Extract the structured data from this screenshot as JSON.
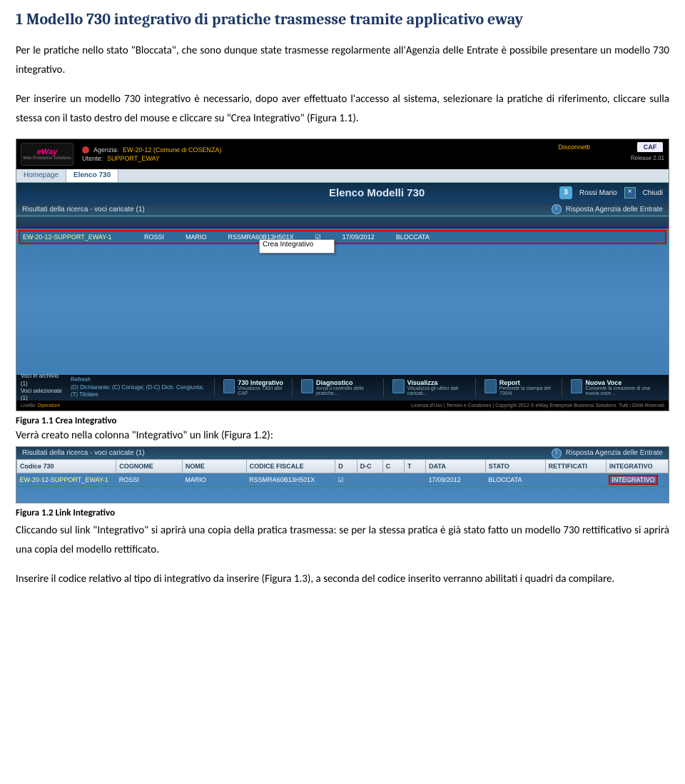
{
  "doc": {
    "heading": "1  Modello 730 integrativo di pratiche trasmesse tramite applicativo eway",
    "para1": "Per le pratiche nello stato \"Bloccata\", che sono dunque state trasmesse regolarmente all'Agenzia delle Entrate è possibile presentare un modello 730 integrativo.",
    "para2": "Per inserire un modello 730 integrativo è necessario, dopo aver effettuato l'accesso al sistema, selezionare la pratiche di riferimento, cliccare sulla stessa con il tasto destro del mouse e cliccare su \"Crea Integrativo\" (Figura 1.1).",
    "caption1": "Figura 1.1 Crea Integrativo",
    "after1": "Verrà creato nella colonna \"Integrativo\" un link (Figura 1.2):",
    "caption2": "Figura 1.2 Link Integrativo",
    "para3": "Cliccando sul link \"Integrativo\" si aprirà una copia della pratica trasmessa: se per la stessa pratica è già stato fatto un modello 730 rettificativo si aprirà una copia del modello rettificato.",
    "para4": "Inserire il codice relativo al tipo di integrativo da inserire (Figura 1.3), a seconda del codice inserito verranno abilitati i quadri da compilare."
  },
  "ss1": {
    "brand": "eWay",
    "brandSub": "Web Enterprise Solutions",
    "agenziaLabel": "Agenzia:",
    "agenziaVal": "EW-20-12 (Comune di COSENZA)",
    "utenteLabel": "Utente:",
    "utenteVal": "SUPPORT_EWAY",
    "disconnect": "Disconnetti",
    "caf": "CAF",
    "release": "Release 2.01",
    "tabHome": "Homepage",
    "tabElenco": "Elenco 730",
    "windowTitle": "Elenco Modelli 730",
    "windowNum": "3",
    "windowUser": "Rossi Mario",
    "close": "×",
    "chiudi": "Chiudi",
    "resultsLabel": "Risultati della ricerca - voci caricate (1)",
    "risposta": "Risposta Agenzia delle Entrate",
    "row": {
      "code": "EW-20-12-SUPPORT_EWAY-1",
      "cognome": "ROSSI",
      "nome": "MARIO",
      "cf": "RSSMRA60B13H501X",
      "data": "17/09/2012",
      "stato": "BLOCCATA"
    },
    "contextMenu": "Crea Integrativo",
    "bottomLeft": {
      "l1": "Voci in archivio (1)",
      "l2": "Voci selezionate (1)",
      "refresh": "Refresh",
      "legend": "(D) Dichiarante; (C) Coniuge; (D-C) Dich. Congiunta; (T) Titolare"
    },
    "btn1": {
      "t": "730 Integrativo",
      "s": "Visualizza 730/I altri CAF"
    },
    "btn2": {
      "t": "Diagnostico",
      "s": "Avvia il controllo delle pratiche..."
    },
    "btn3": {
      "t": "Visualizza",
      "s": "Visualizza gli ultimi dati caricati..."
    },
    "btn4": {
      "t": "Report",
      "s": "Permette la stampa del 730/4"
    },
    "btn5": {
      "t": "Nuova Voce",
      "s": "Consente la creazione di una nuova voce..."
    },
    "footer": {
      "livello": "Livello:",
      "operatore": "Operatore",
      "licenza": "Licenza d'Uso",
      "termini": "Termini e Condizioni",
      "copy": "Copyright 2012 © eWay Enterprise Business Solutions. Tutti i Diritti Riservati"
    }
  },
  "ss2": {
    "resultsLabel": "Risultati della ricerca - voci caricate (1)",
    "risposta": "Risposta Agenzia delle Entrate",
    "cols": {
      "c730": "Codice 730",
      "cognome": "COGNOME",
      "nome": "NOME",
      "cf": "CODICE FISCALE",
      "d": "D",
      "dc": "D-C",
      "c": "C",
      "t": "T",
      "data": "DATA",
      "stato": "STATO",
      "rett": "RETTIFICATI",
      "integ": "INTEGRATIVO"
    },
    "row": {
      "code": "EW-20-12-SUPPORT_EWAY-1",
      "cognome": "ROSSI",
      "nome": "MARIO",
      "cf": "RSSMRA60B13H501X",
      "d": "☑",
      "data": "17/09/2012",
      "stato": "BLOCCATA",
      "integ": "INTEGRATIVO"
    }
  }
}
